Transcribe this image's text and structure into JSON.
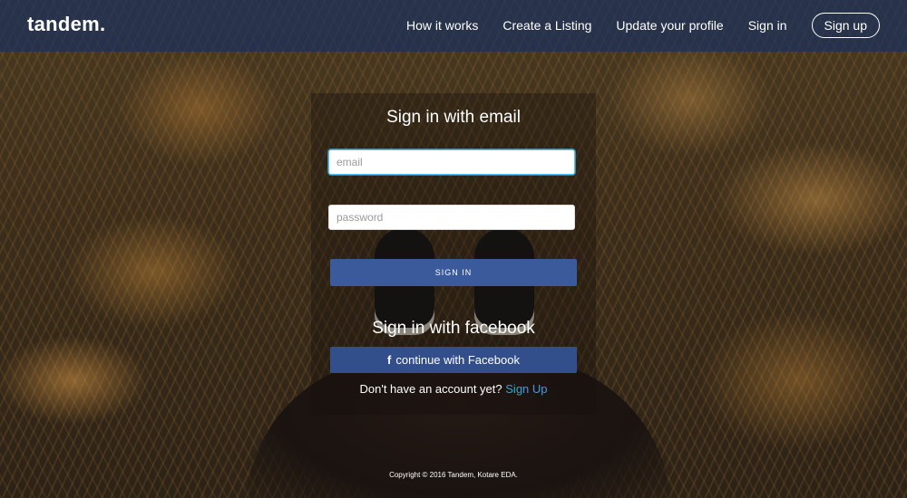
{
  "header": {
    "logo": "tandem.",
    "nav": [
      {
        "label": "How it works"
      },
      {
        "label": "Create a Listing"
      },
      {
        "label": "Update your profile"
      },
      {
        "label": "Sign in"
      }
    ],
    "signup_label": "Sign up"
  },
  "email_section": {
    "title": "Sign in with email",
    "email_placeholder": "email",
    "password_placeholder": "password",
    "submit_label": "SIGN IN"
  },
  "facebook_section": {
    "title": "Sign in with facebook",
    "button_label": "continue with Facebook",
    "icon": "facebook-f-icon"
  },
  "signup_prompt": {
    "text": "Don't have an account yet?",
    "link": "Sign Up"
  },
  "footer": {
    "copyright": "Copyright © 2016 Tandem, Kotare EDA."
  },
  "colors": {
    "header_bg": "#1a305c",
    "primary_button": "#3a5a9c",
    "facebook_button": "#324f8c",
    "link": "#2ba6de",
    "focus_border": "#4fc3f7"
  }
}
